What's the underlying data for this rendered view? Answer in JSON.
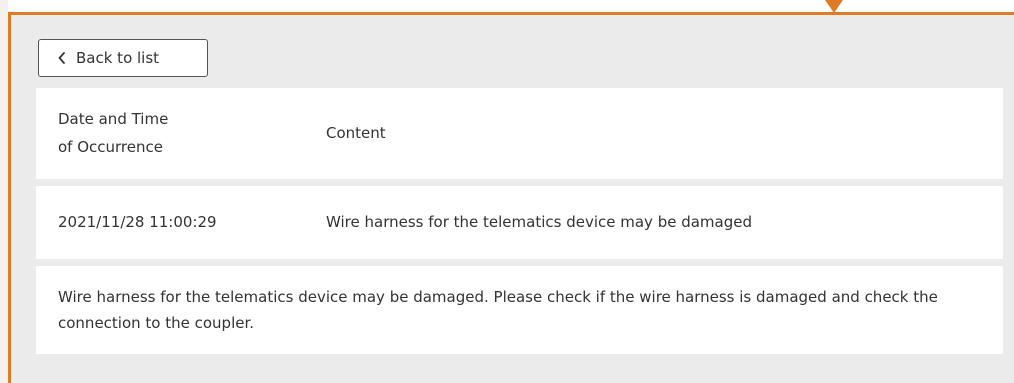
{
  "back_button": {
    "label": "Back to list"
  },
  "table": {
    "header": {
      "date_line1": "Date and Time",
      "date_line2": "of Occurrence",
      "content": "Content"
    },
    "rows": [
      {
        "datetime": "2021/11/28 11:00:29",
        "content": "Wire harness for the telematics device may be damaged"
      }
    ]
  },
  "detail": {
    "text": "Wire harness for the telematics device may be damaged. Please check if the wire harness is damaged and check the connection to the coupler."
  },
  "colors": {
    "accent": "#e07b24",
    "panel_bg": "#ebebeb",
    "card_bg": "#ffffff",
    "text": "#333333"
  },
  "icons": {
    "back": "chevron-left-icon",
    "pointer": "caret-down-icon"
  }
}
